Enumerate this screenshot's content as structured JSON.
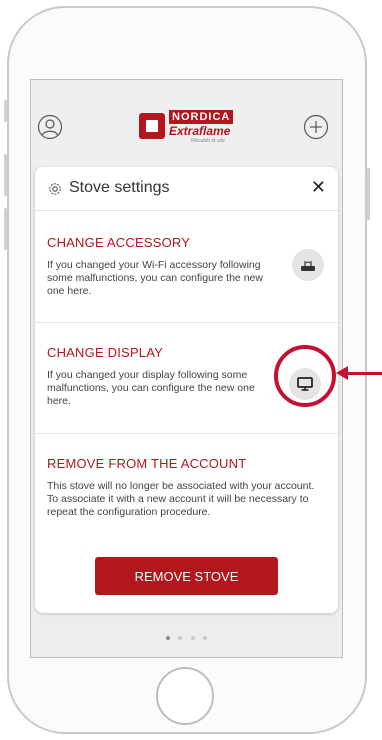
{
  "header": {
    "brand_name": "NORDICA",
    "brand_sub": "Extraflame",
    "brand_tagline": "Riscaldo la vita"
  },
  "settings": {
    "title": "Stove settings",
    "close_label": "✕",
    "change_accessory": {
      "title": "CHANGE ACCESSORY",
      "description": "If you changed your Wi-Fi accessory following some malfunctions, you can configure the new one here."
    },
    "change_display": {
      "title": "CHANGE DISPLAY",
      "description": "If you changed your display following some malfunctions, you can configure the new one here."
    },
    "remove_account": {
      "title": "REMOVE FROM THE ACCOUNT",
      "description": "This stove will no longer be associated with your account. To associate it with a new account it will be necessary to repeat the configuration procedure.",
      "button_label": "REMOVE STOVE"
    }
  },
  "pager": {
    "pages": 4,
    "active": 1
  },
  "icons": {
    "profile": "user-icon",
    "add": "plus-circle-icon",
    "settings": "gear-icon",
    "router": "router-icon",
    "display": "monitor-icon"
  },
  "colors": {
    "accent": "#b3161c",
    "annotation": "#c8102e",
    "button_bg": "#e4e4e4"
  }
}
